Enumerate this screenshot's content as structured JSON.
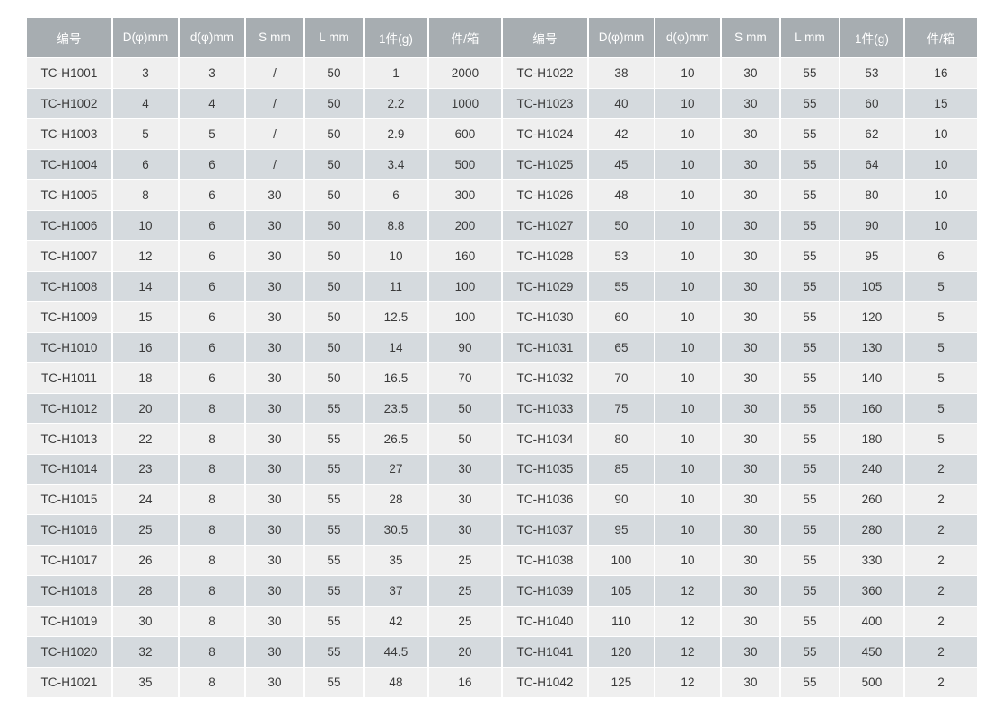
{
  "table": {
    "columns": [
      {
        "key": "code",
        "label": "编号"
      },
      {
        "key": "D",
        "label": "D(φ)mm"
      },
      {
        "key": "d",
        "label": "d(φ)mm"
      },
      {
        "key": "S",
        "label": "S mm"
      },
      {
        "key": "L",
        "label": "L mm"
      },
      {
        "key": "weight",
        "label": "1件(g)"
      },
      {
        "key": "box",
        "label": "件/箱"
      }
    ],
    "left_rows": [
      [
        "TC-H1001",
        "3",
        "3",
        "/",
        "50",
        "1",
        "2000"
      ],
      [
        "TC-H1002",
        "4",
        "4",
        "/",
        "50",
        "2.2",
        "1000"
      ],
      [
        "TC-H1003",
        "5",
        "5",
        "/",
        "50",
        "2.9",
        "600"
      ],
      [
        "TC-H1004",
        "6",
        "6",
        "/",
        "50",
        "3.4",
        "500"
      ],
      [
        "TC-H1005",
        "8",
        "6",
        "30",
        "50",
        "6",
        "300"
      ],
      [
        "TC-H1006",
        "10",
        "6",
        "30",
        "50",
        "8.8",
        "200"
      ],
      [
        "TC-H1007",
        "12",
        "6",
        "30",
        "50",
        "10",
        "160"
      ],
      [
        "TC-H1008",
        "14",
        "6",
        "30",
        "50",
        "11",
        "100"
      ],
      [
        "TC-H1009",
        "15",
        "6",
        "30",
        "50",
        "12.5",
        "100"
      ],
      [
        "TC-H1010",
        "16",
        "6",
        "30",
        "50",
        "14",
        "90"
      ],
      [
        "TC-H1011",
        "18",
        "6",
        "30",
        "50",
        "16.5",
        "70"
      ],
      [
        "TC-H1012",
        "20",
        "8",
        "30",
        "55",
        "23.5",
        "50"
      ],
      [
        "TC-H1013",
        "22",
        "8",
        "30",
        "55",
        "26.5",
        "50"
      ],
      [
        "TC-H1014",
        "23",
        "8",
        "30",
        "55",
        "27",
        "30"
      ],
      [
        "TC-H1015",
        "24",
        "8",
        "30",
        "55",
        "28",
        "30"
      ],
      [
        "TC-H1016",
        "25",
        "8",
        "30",
        "55",
        "30.5",
        "30"
      ],
      [
        "TC-H1017",
        "26",
        "8",
        "30",
        "55",
        "35",
        "25"
      ],
      [
        "TC-H1018",
        "28",
        "8",
        "30",
        "55",
        "37",
        "25"
      ],
      [
        "TC-H1019",
        "30",
        "8",
        "30",
        "55",
        "42",
        "25"
      ],
      [
        "TC-H1020",
        "32",
        "8",
        "30",
        "55",
        "44.5",
        "20"
      ],
      [
        "TC-H1021",
        "35",
        "8",
        "30",
        "55",
        "48",
        "16"
      ]
    ],
    "right_rows": [
      [
        "TC-H1022",
        "38",
        "10",
        "30",
        "55",
        "53",
        "16"
      ],
      [
        "TC-H1023",
        "40",
        "10",
        "30",
        "55",
        "60",
        "15"
      ],
      [
        "TC-H1024",
        "42",
        "10",
        "30",
        "55",
        "62",
        "10"
      ],
      [
        "TC-H1025",
        "45",
        "10",
        "30",
        "55",
        "64",
        "10"
      ],
      [
        "TC-H1026",
        "48",
        "10",
        "30",
        "55",
        "80",
        "10"
      ],
      [
        "TC-H1027",
        "50",
        "10",
        "30",
        "55",
        "90",
        "10"
      ],
      [
        "TC-H1028",
        "53",
        "10",
        "30",
        "55",
        "95",
        "6"
      ],
      [
        "TC-H1029",
        "55",
        "10",
        "30",
        "55",
        "105",
        "5"
      ],
      [
        "TC-H1030",
        "60",
        "10",
        "30",
        "55",
        "120",
        "5"
      ],
      [
        "TC-H1031",
        "65",
        "10",
        "30",
        "55",
        "130",
        "5"
      ],
      [
        "TC-H1032",
        "70",
        "10",
        "30",
        "55",
        "140",
        "5"
      ],
      [
        "TC-H1033",
        "75",
        "10",
        "30",
        "55",
        "160",
        "5"
      ],
      [
        "TC-H1034",
        "80",
        "10",
        "30",
        "55",
        "180",
        "5"
      ],
      [
        "TC-H1035",
        "85",
        "10",
        "30",
        "55",
        "240",
        "2"
      ],
      [
        "TC-H1036",
        "90",
        "10",
        "30",
        "55",
        "260",
        "2"
      ],
      [
        "TC-H1037",
        "95",
        "10",
        "30",
        "55",
        "280",
        "2"
      ],
      [
        "TC-H1038",
        "100",
        "10",
        "30",
        "55",
        "330",
        "2"
      ],
      [
        "TC-H1039",
        "105",
        "12",
        "30",
        "55",
        "360",
        "2"
      ],
      [
        "TC-H1040",
        "110",
        "12",
        "30",
        "55",
        "400",
        "2"
      ],
      [
        "TC-H1041",
        "120",
        "12",
        "30",
        "55",
        "450",
        "2"
      ],
      [
        "TC-H1042",
        "125",
        "12",
        "30",
        "55",
        "500",
        "2"
      ]
    ]
  },
  "colors": {
    "header_bg": "#a7adb1",
    "header_text": "#ffffff",
    "row_odd_bg": "#efefef",
    "row_even_bg": "#d5dade",
    "cell_text": "#3a3a3a",
    "grid_line": "#ffffff",
    "page_bg": "#ffffff"
  }
}
